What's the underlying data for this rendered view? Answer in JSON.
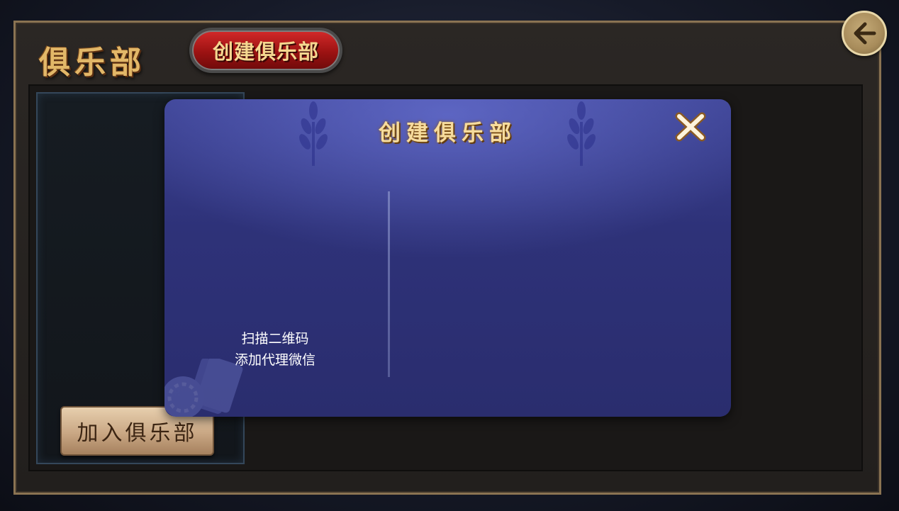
{
  "header": {
    "title": "俱乐部",
    "create_button_label": "创建俱乐部",
    "back_icon": "arrow-left-icon"
  },
  "sidebar": {
    "join_button_label": "加入俱乐部"
  },
  "modal": {
    "title": "创建俱乐部",
    "close_icon": "close-icon",
    "qr_caption_line1": "扫描二维码",
    "qr_caption_line2": "添加代理微信"
  },
  "colors": {
    "frame_border": "#8a7352",
    "gold_text": "#e2b768",
    "create_button_red": "#b01818",
    "modal_bg": "#2e3279",
    "join_button": "#c9a784"
  }
}
